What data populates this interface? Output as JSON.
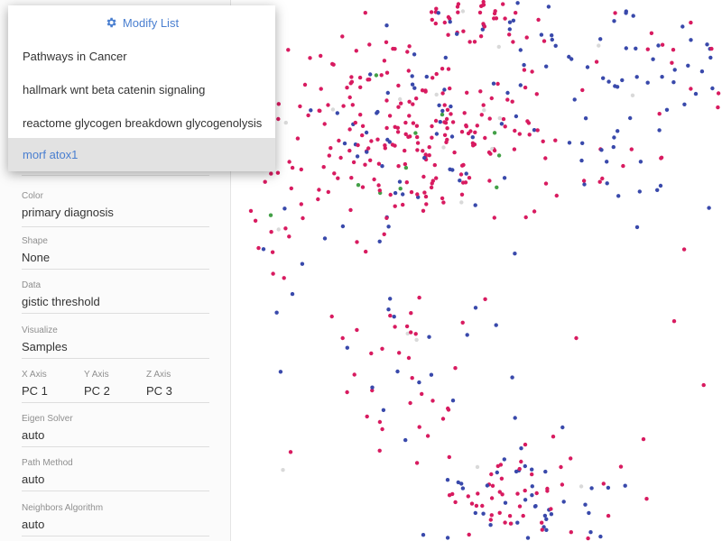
{
  "dropdown": {
    "header_label": "Modify List",
    "header_icon": "gear-icon",
    "items": [
      {
        "label": "Pathways in Cancer",
        "selected": false
      },
      {
        "label": "hallmark wnt beta catenin signaling",
        "selected": false
      },
      {
        "label": "reactome glycogen breakdown glycogenolysis",
        "selected": false
      },
      {
        "label": "morf atox1",
        "selected": true
      }
    ]
  },
  "sidebar": {
    "color": {
      "label": "Color",
      "value": "primary diagnosis"
    },
    "shape": {
      "label": "Shape",
      "value": "None"
    },
    "data": {
      "label": "Data",
      "value": "gistic threshold"
    },
    "visualize": {
      "label": "Visualize",
      "value": "Samples"
    },
    "axes": [
      {
        "label": "X Axis",
        "value": "PC 1"
      },
      {
        "label": "Y Axis",
        "value": "PC 2"
      },
      {
        "label": "Z Axis",
        "value": "PC 3"
      }
    ],
    "eigen_solver": {
      "label": "Eigen Solver",
      "value": "auto"
    },
    "path_method": {
      "label": "Path Method",
      "value": "auto"
    },
    "neighbors_algorithm": {
      "label": "Neighbors Algorithm",
      "value": "auto"
    }
  },
  "colors": {
    "accent": "#4a7fd0",
    "point_pink": "#d81b60",
    "point_blue": "#3949ab",
    "point_green": "#43a047",
    "point_orange": "#fb8c00",
    "point_gray": "#d9d9d9"
  }
}
